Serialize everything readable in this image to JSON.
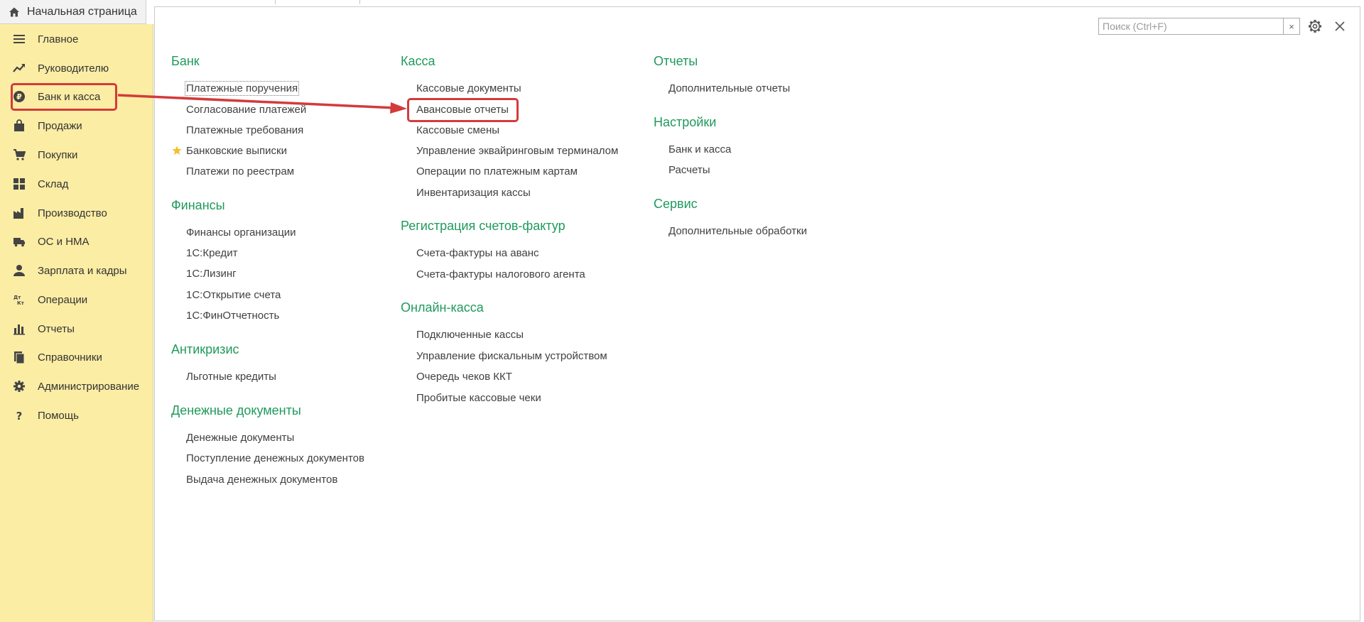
{
  "top_tab": {
    "label": "Начальная страница"
  },
  "sidebar": {
    "items": [
      {
        "label": "Главное",
        "icon": "list-icon"
      },
      {
        "label": "Руководителю",
        "icon": "trend-up-icon"
      },
      {
        "label": "Банк и касса",
        "icon": "ruble-coin-icon"
      },
      {
        "label": "Продажи",
        "icon": "shopping-bag-icon"
      },
      {
        "label": "Покупки",
        "icon": "cart-icon"
      },
      {
        "label": "Склад",
        "icon": "grid-blocks-icon"
      },
      {
        "label": "Производство",
        "icon": "factory-icon"
      },
      {
        "label": "ОС и НМА",
        "icon": "truck-icon"
      },
      {
        "label": "Зарплата и кадры",
        "icon": "person-icon"
      },
      {
        "label": "Операции",
        "icon": "dt-kt-icon"
      },
      {
        "label": "Отчеты",
        "icon": "bar-chart-icon"
      },
      {
        "label": "Справочники",
        "icon": "books-icon"
      },
      {
        "label": "Администрирование",
        "icon": "gear-icon"
      },
      {
        "label": "Помощь",
        "icon": "question-icon"
      }
    ]
  },
  "search": {
    "placeholder": "Поиск (Ctrl+F)",
    "value": "",
    "clear": "×"
  },
  "sections": {
    "bank": {
      "title": "Банк",
      "links": [
        "Платежные поручения",
        "Согласование платежей",
        "Платежные требования",
        "Банковские выписки",
        "Платежи по реестрам"
      ]
    },
    "finance": {
      "title": "Финансы",
      "links": [
        "Финансы организации",
        "1С:Кредит",
        "1С:Лизинг",
        "1С:Открытие счета",
        "1С:ФинОтчетность"
      ]
    },
    "anticrisis": {
      "title": "Антикризис",
      "links": [
        "Льготные кредиты"
      ]
    },
    "money_docs": {
      "title": "Денежные документы",
      "links": [
        "Денежные документы",
        "Поступление денежных документов",
        "Выдача денежных документов"
      ]
    },
    "kassa": {
      "title": "Касса",
      "links": [
        "Кассовые документы",
        "Авансовые отчеты",
        "Кассовые смены",
        "Управление эквайринговым терминалом",
        "Операции по платежным картам",
        "Инвентаризация кассы"
      ]
    },
    "invoices": {
      "title": "Регистрация счетов-фактур",
      "links": [
        "Счета-фактуры на аванс",
        "Счета-фактуры налогового агента"
      ]
    },
    "online_kassa": {
      "title": "Онлайн-касса",
      "links": [
        "Подключенные кассы",
        "Управление фискальным устройством",
        "Очередь чеков ККТ",
        "Пробитые кассовые чеки"
      ]
    },
    "reports": {
      "title": "Отчеты",
      "links": [
        "Дополнительные отчеты"
      ]
    },
    "settings": {
      "title": "Настройки",
      "links": [
        "Банк и касса",
        "Расчеты"
      ]
    },
    "service": {
      "title": "Сервис",
      "links": [
        "Дополнительные обработки"
      ]
    }
  },
  "colors": {
    "sidebar_bg": "#fbeda4",
    "section_title": "#1f9a5d",
    "highlight": "#d33b3b",
    "star": "#f2c12e"
  }
}
